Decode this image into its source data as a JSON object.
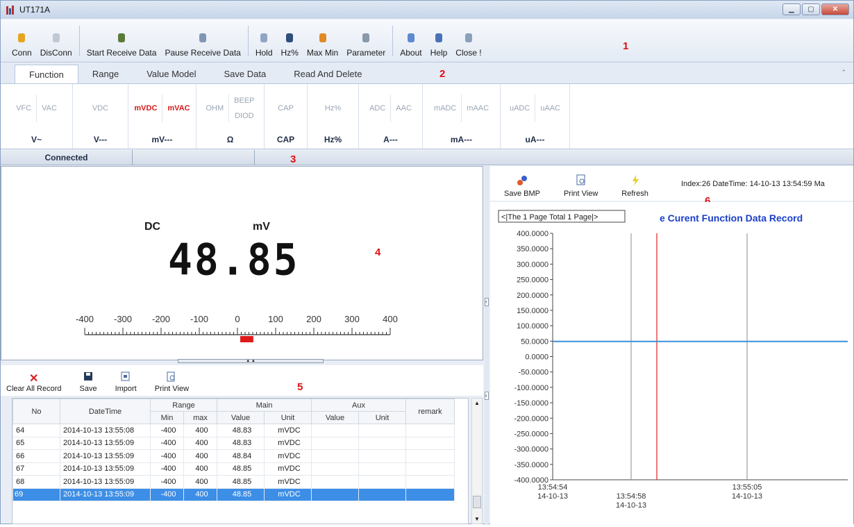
{
  "window": {
    "title": "UT171A"
  },
  "toolbar": {
    "buttons": [
      {
        "label": "Conn",
        "icon": "bulb-on-icon"
      },
      {
        "label": "DisConn",
        "icon": "bulb-off-icon"
      },
      {
        "label": "Start Receive Data",
        "icon": "start-receive-icon"
      },
      {
        "label": "Pause Receive Data",
        "icon": "pause-receive-icon"
      },
      {
        "label": "Hold",
        "icon": "hold-icon"
      },
      {
        "label": "Hz%",
        "icon": "hz-icon"
      },
      {
        "label": "Max Min",
        "icon": "max-min-icon"
      },
      {
        "label": "Parameter",
        "icon": "parameter-icon"
      },
      {
        "label": "About",
        "icon": "about-icon"
      },
      {
        "label": "Help",
        "icon": "help-icon"
      },
      {
        "label": "Close !",
        "icon": "close-app-icon"
      }
    ],
    "marker": "1"
  },
  "tabs": {
    "items": [
      "Function",
      "Range",
      "Value Model",
      "Save Data",
      "Read And Delete"
    ],
    "active": "Function",
    "marker": "2"
  },
  "ribbon": {
    "groups": [
      {
        "label": "V~",
        "items": [
          "VFC",
          "VAC"
        ]
      },
      {
        "label": "V---",
        "items": [
          "VDC"
        ]
      },
      {
        "label": "mV---",
        "items": [
          "mVDC",
          "mVAC"
        ]
      },
      {
        "label": "Ω",
        "items": [
          "OHM",
          "BEEP",
          "DIOD"
        ]
      },
      {
        "label": "CAP",
        "items": [
          "CAP"
        ]
      },
      {
        "label": "Hz%",
        "items": [
          "Hz%"
        ]
      },
      {
        "label": "A---",
        "items": [
          "ADC",
          "AAC"
        ]
      },
      {
        "label": "mA---",
        "items": [
          "mADC",
          "mAAC"
        ]
      },
      {
        "label": "uA---",
        "items": [
          "uADC",
          "uAAC"
        ]
      }
    ]
  },
  "status": {
    "text": "Connected",
    "marker": "3"
  },
  "display": {
    "mode": "DC",
    "unit": "mV",
    "value": "48.85",
    "marker": "4",
    "scale_labels": [
      "-400",
      "-300",
      "-200",
      "-100",
      "0",
      "100",
      "200",
      "300",
      "400"
    ],
    "scale_value": 48.85,
    "scale_min": -400,
    "scale_max": 400
  },
  "record_toolbar": {
    "buttons": [
      "Clear All Record",
      "Save",
      "Import",
      "Print View"
    ],
    "marker": "5"
  },
  "table": {
    "headers": {
      "no": "No",
      "datetime": "DateTime",
      "range": "Range",
      "main": "Main",
      "aux": "Aux",
      "remark": "remark",
      "min": "Min",
      "max": "max",
      "value": "Value",
      "unit": "Unit"
    },
    "rows": [
      {
        "no": "64",
        "dt": "2014-10-13 13:55:08",
        "min": "-400",
        "max": "400",
        "value": "48.83",
        "unit": "mVDC"
      },
      {
        "no": "65",
        "dt": "2014-10-13 13:55:09",
        "min": "-400",
        "max": "400",
        "value": "48.83",
        "unit": "mVDC"
      },
      {
        "no": "66",
        "dt": "2014-10-13 13:55:09",
        "min": "-400",
        "max": "400",
        "value": "48.84",
        "unit": "mVDC"
      },
      {
        "no": "67",
        "dt": "2014-10-13 13:55:09",
        "min": "-400",
        "max": "400",
        "value": "48.85",
        "unit": "mVDC"
      },
      {
        "no": "68",
        "dt": "2014-10-13 13:55:09",
        "min": "-400",
        "max": "400",
        "value": "48.85",
        "unit": "mVDC"
      },
      {
        "no": "69",
        "dt": "2014-10-13 13:55:09",
        "min": "-400",
        "max": "400",
        "value": "48.85",
        "unit": "mVDC",
        "selected": true
      }
    ]
  },
  "chart_toolbar": {
    "buttons": [
      "Save BMP",
      "Print View",
      "Refresh"
    ],
    "info": "Index:26 DateTime:  14-10-13 13:54:59  Ma",
    "marker": "6"
  },
  "chart_data": {
    "type": "line",
    "title": "e Curent Function Data Record",
    "pager": "<|The 1 Page Total 1 Page|>",
    "ylim": [
      -400,
      400
    ],
    "yticks": [
      "400.0000",
      "350.0000",
      "300.0000",
      "250.0000",
      "200.0000",
      "150.0000",
      "100.0000",
      "50.0000",
      "0.0000",
      "-50.0000",
      "-100.0000",
      "-150.0000",
      "-200.0000",
      "-250.0000",
      "-300.0000",
      "-350.0000",
      "-400.0000"
    ],
    "xticks": [
      {
        "time": "13:54:54",
        "date": "14-10-13"
      },
      {
        "time": "13:54:58",
        "date": "14-10-13"
      },
      {
        "time": "13:55:05",
        "date": "14-10-13"
      }
    ],
    "series": [
      {
        "values": [
          48.8,
          48.8,
          48.8,
          48.85,
          48.85,
          48.85,
          48.85,
          48.85,
          48.85,
          48.85
        ],
        "color": "#3a8fd9"
      }
    ],
    "cursor_color": "#e02020"
  }
}
